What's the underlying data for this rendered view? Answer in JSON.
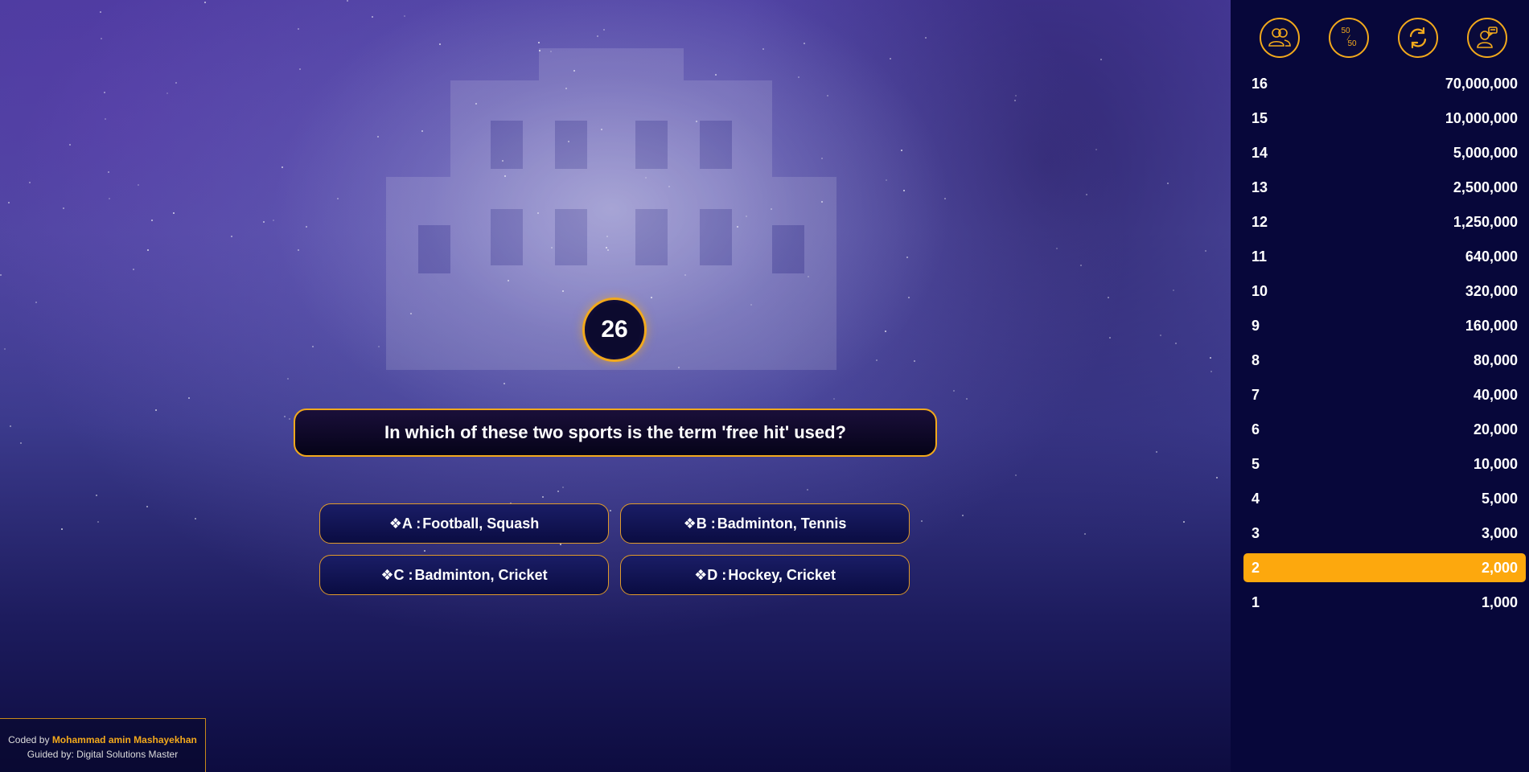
{
  "timer": {
    "value": "26"
  },
  "question": {
    "text": "In which of these two sports is the term 'free hit' used?"
  },
  "answers": [
    {
      "letter_prefix": "❖A :",
      "text": "Football, Squash"
    },
    {
      "letter_prefix": "❖B :",
      "text": "Badminton, Tennis"
    },
    {
      "letter_prefix": "❖C :",
      "text": "Badminton, Cricket"
    },
    {
      "letter_prefix": "❖D :",
      "text": "Hockey, Cricket"
    }
  ],
  "lifelines": [
    {
      "name": "ask-the-audience",
      "icon": "audience-icon"
    },
    {
      "name": "fifty-fifty",
      "icon": "fifty-fifty-icon",
      "label_top": "50",
      "label_bottom": "50"
    },
    {
      "name": "switch-question",
      "icon": "refresh-icon"
    },
    {
      "name": "phone-a-friend",
      "icon": "phone-friend-icon"
    }
  ],
  "prize_ladder": [
    {
      "level": "16",
      "amount": "70,000,000"
    },
    {
      "level": "15",
      "amount": "10,000,000"
    },
    {
      "level": "14",
      "amount": "5,000,000"
    },
    {
      "level": "13",
      "amount": "2,500,000"
    },
    {
      "level": "12",
      "amount": "1,250,000"
    },
    {
      "level": "11",
      "amount": "640,000"
    },
    {
      "level": "10",
      "amount": "320,000"
    },
    {
      "level": "9",
      "amount": "160,000"
    },
    {
      "level": "8",
      "amount": "80,000"
    },
    {
      "level": "7",
      "amount": "40,000"
    },
    {
      "level": "6",
      "amount": "20,000"
    },
    {
      "level": "5",
      "amount": "10,000"
    },
    {
      "level": "4",
      "amount": "5,000"
    },
    {
      "level": "3",
      "amount": "3,000"
    },
    {
      "level": "2",
      "amount": "2,000",
      "current": true
    },
    {
      "level": "1",
      "amount": "1,000"
    }
  ],
  "credits": {
    "coded_by_prefix": "Coded by ",
    "author": "Mohammad amin Mashayekhan",
    "guided_by": "Guided by: Digital Solutions Master"
  },
  "colors": {
    "accent": "#f2a91c",
    "active_rung": "#fda80d",
    "sidebar_bg": "#07073a",
    "answer_bg": "#1a1d66"
  }
}
